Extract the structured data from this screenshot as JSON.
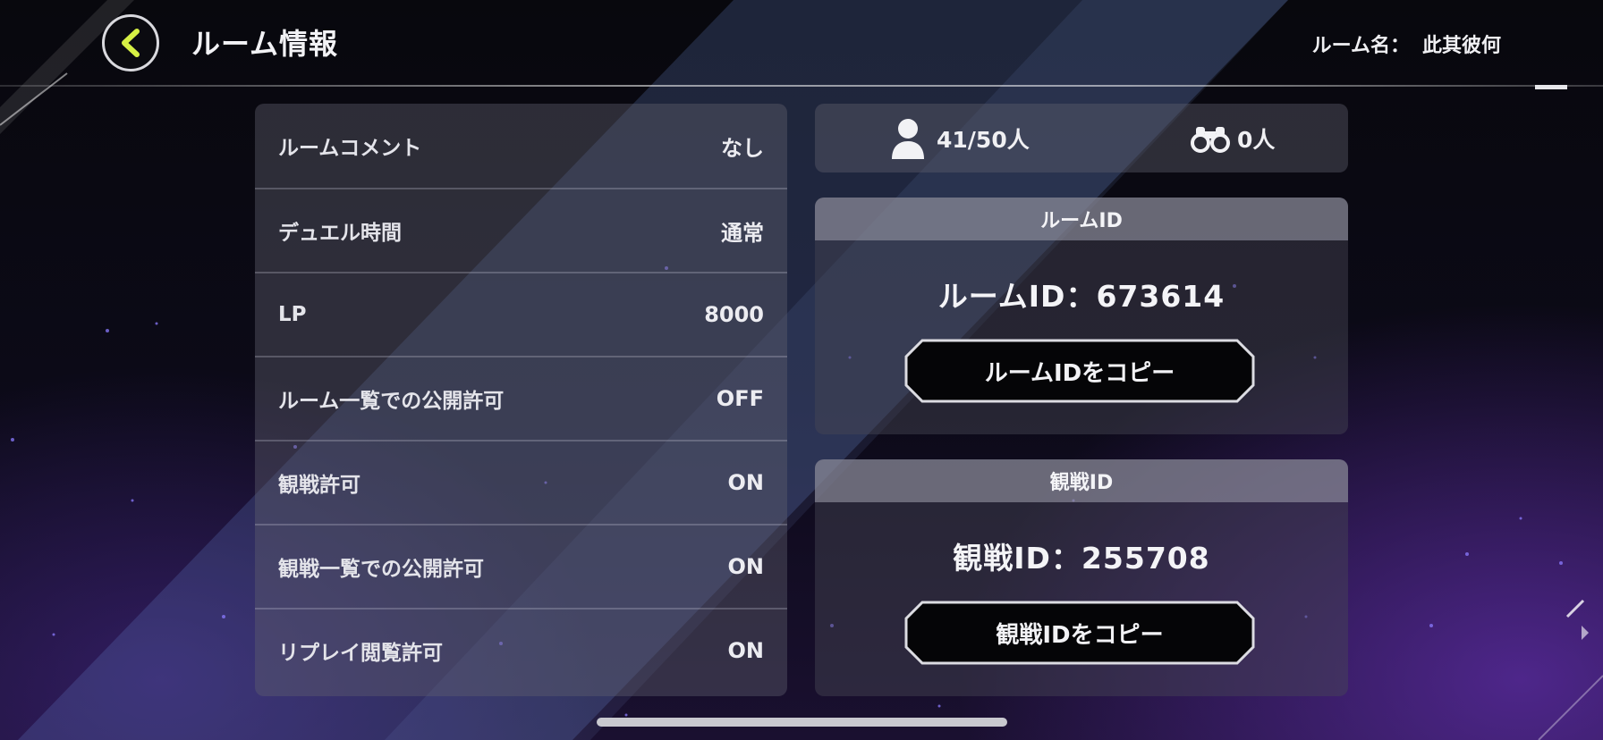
{
  "header": {
    "title": "ルーム情報",
    "room_name_label": "ルーム名：",
    "room_name_value": "此其彼何"
  },
  "settings": [
    {
      "label": "ルームコメント",
      "value": "なし"
    },
    {
      "label": "デュエル時間",
      "value": "通常"
    },
    {
      "label": "LP",
      "value": "8000"
    },
    {
      "label": "ルーム一覧での公開許可",
      "value": "OFF"
    },
    {
      "label": "観戦許可",
      "value": "ON"
    },
    {
      "label": "観戦一覧での公開許可",
      "value": "ON"
    },
    {
      "label": "リプレイ閲覧許可",
      "value": "ON"
    }
  ],
  "stats": {
    "players": "41/50人",
    "spectators": "0人"
  },
  "room_id_card": {
    "header": "ルームID",
    "id_text": "ルームID：673614",
    "copy_label": "ルームIDをコピー"
  },
  "watch_id_card": {
    "header": "観戦ID",
    "id_text": "観戦ID：255708",
    "copy_label": "観戦IDをコピー"
  },
  "colors": {
    "accent": "#d6f044",
    "panel": "#5f5f6e",
    "background": "#0a0a12",
    "glow": "#602eaa"
  },
  "icons": {
    "back": "chevron-left-icon",
    "players": "person-icon",
    "spectators": "binoculars-icon"
  }
}
